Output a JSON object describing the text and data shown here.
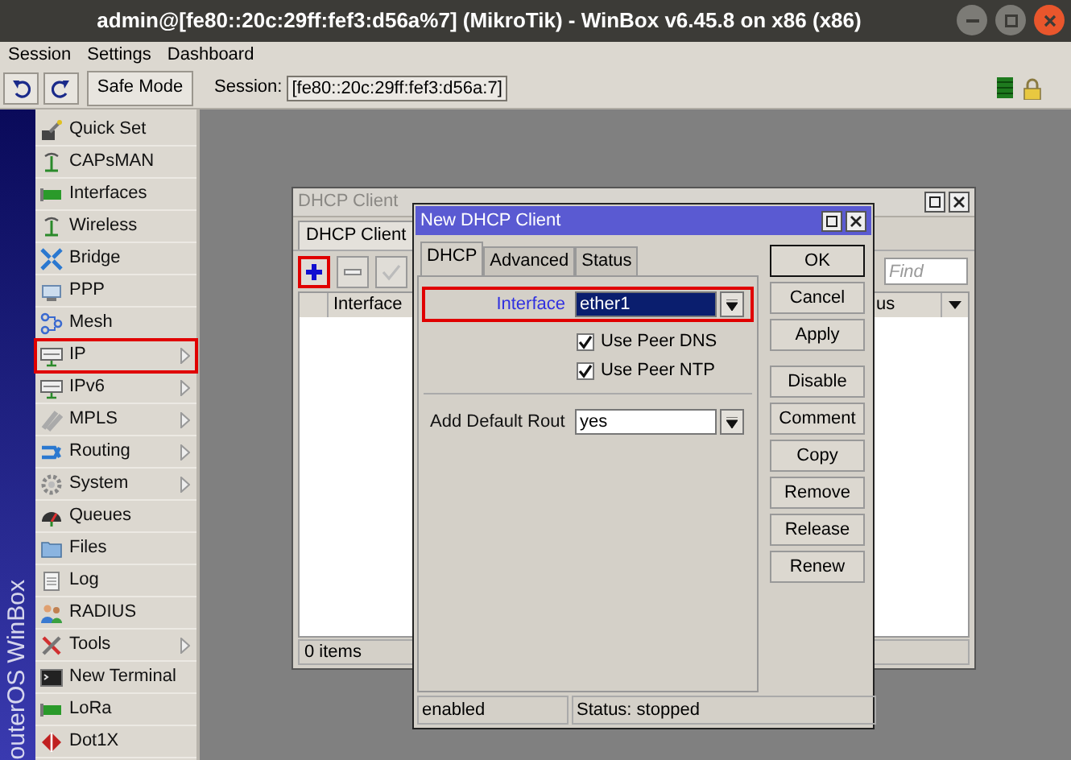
{
  "window": {
    "title": "admin@[fe80::20c:29ff:fef3:d56a%7] (MikroTik) - WinBox v6.45.8 on x86 (x86)"
  },
  "menu": [
    "Session",
    "Settings",
    "Dashboard"
  ],
  "toolbar": {
    "safe_mode": "Safe Mode",
    "session_label": "Session:",
    "session_value": "[fe80::20c:29ff:fef3:d56a:7]"
  },
  "sidebar": {
    "brand": "outerOS WinBox",
    "items": [
      {
        "label": "Quick Set",
        "submenu": false,
        "highlighted": false
      },
      {
        "label": "CAPsMAN",
        "submenu": false,
        "highlighted": false
      },
      {
        "label": "Interfaces",
        "submenu": false,
        "highlighted": false
      },
      {
        "label": "Wireless",
        "submenu": false,
        "highlighted": false
      },
      {
        "label": "Bridge",
        "submenu": false,
        "highlighted": false
      },
      {
        "label": "PPP",
        "submenu": false,
        "highlighted": false
      },
      {
        "label": "Mesh",
        "submenu": false,
        "highlighted": false
      },
      {
        "label": "IP",
        "submenu": true,
        "highlighted": true
      },
      {
        "label": "IPv6",
        "submenu": true,
        "highlighted": false
      },
      {
        "label": "MPLS",
        "submenu": true,
        "highlighted": false
      },
      {
        "label": "Routing",
        "submenu": true,
        "highlighted": false
      },
      {
        "label": "System",
        "submenu": true,
        "highlighted": false
      },
      {
        "label": "Queues",
        "submenu": false,
        "highlighted": false
      },
      {
        "label": "Files",
        "submenu": false,
        "highlighted": false
      },
      {
        "label": "Log",
        "submenu": false,
        "highlighted": false
      },
      {
        "label": "RADIUS",
        "submenu": false,
        "highlighted": false
      },
      {
        "label": "Tools",
        "submenu": true,
        "highlighted": false
      },
      {
        "label": "New Terminal",
        "submenu": false,
        "highlighted": false
      },
      {
        "label": "LoRa",
        "submenu": false,
        "highlighted": false
      },
      {
        "label": "Dot1X",
        "submenu": false,
        "highlighted": false
      }
    ]
  },
  "dhcp_client_window": {
    "title": "DHCP Client",
    "tabs": [
      {
        "label": "DHCP Client",
        "selected": true
      }
    ],
    "toolbar_buttons": [
      {
        "kind": "add",
        "highlighted": true
      },
      {
        "kind": "remove",
        "highlighted": false
      },
      {
        "kind": "enable",
        "highlighted": false
      }
    ],
    "find_placeholder": "Find",
    "columns": [
      "Interface",
      "us"
    ],
    "footer": "0 items"
  },
  "new_dhcp_client_window": {
    "title": "New DHCP Client",
    "tabs": [
      {
        "label": "DHCP",
        "selected": true
      },
      {
        "label": "Advanced",
        "selected": false
      },
      {
        "label": "Status",
        "selected": false
      }
    ],
    "fields": [
      {
        "kind": "select",
        "label": "Interface",
        "value": "ether1",
        "focused": true,
        "highlighted": true
      },
      {
        "kind": "checkbox",
        "label": "Use Peer DNS",
        "checked": true
      },
      {
        "kind": "checkbox",
        "label": "Use Peer NTP",
        "checked": true
      },
      {
        "kind": "separator"
      },
      {
        "kind": "select",
        "label": "Add Default Rout",
        "value": "yes",
        "focused": false,
        "highlighted": false
      }
    ],
    "button_groups": [
      [
        {
          "label": "OK",
          "default": true
        },
        {
          "label": "Cancel",
          "default": false
        },
        {
          "label": "Apply",
          "default": false
        }
      ],
      [
        {
          "label": "Disable",
          "default": false
        },
        {
          "label": "Comment",
          "default": false
        },
        {
          "label": "Copy",
          "default": false
        },
        {
          "label": "Remove",
          "default": false
        },
        {
          "label": "Release",
          "default": false
        },
        {
          "label": "Renew",
          "default": false
        }
      ]
    ],
    "status_left": "enabled",
    "status_right": "Status: stopped"
  }
}
